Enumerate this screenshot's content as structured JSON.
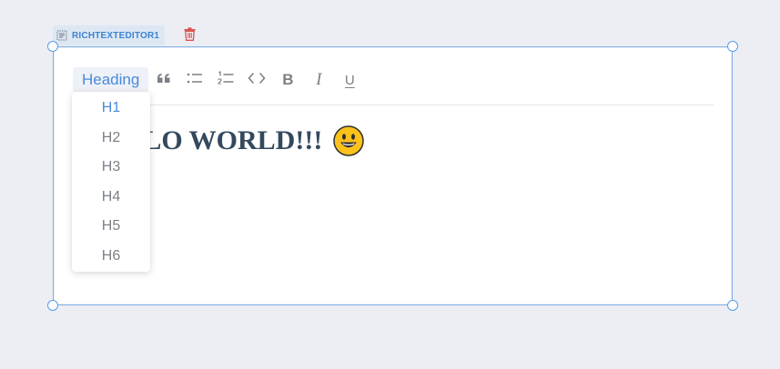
{
  "component": {
    "name": "RICHTEXTEDITOR1"
  },
  "toolbar": {
    "heading_label": "Heading",
    "buttons": [
      {
        "name": "blockquote",
        "glyph": "quote-icon"
      },
      {
        "name": "bulleted-list",
        "glyph": "bullet-list-icon"
      },
      {
        "name": "numbered-list",
        "glyph": "numbered-list-icon"
      },
      {
        "name": "code",
        "glyph": "code-icon"
      },
      {
        "name": "bold",
        "label": "B"
      },
      {
        "name": "italic",
        "label": "I"
      },
      {
        "name": "underline",
        "label": "U"
      }
    ]
  },
  "content": {
    "text": "HELLO WORLD!!!",
    "emoji": "grinning-face"
  },
  "dropdown": {
    "items": [
      "H1",
      "H2",
      "H3",
      "H4",
      "H5",
      "H6"
    ],
    "selected": "H1"
  },
  "colors": {
    "accent": "#4a8ad8",
    "selection_border": "#7fb1e8",
    "heading_text": "#34495e",
    "toolbar_icon": "#7c8087",
    "delete_icon": "#d9534f"
  }
}
